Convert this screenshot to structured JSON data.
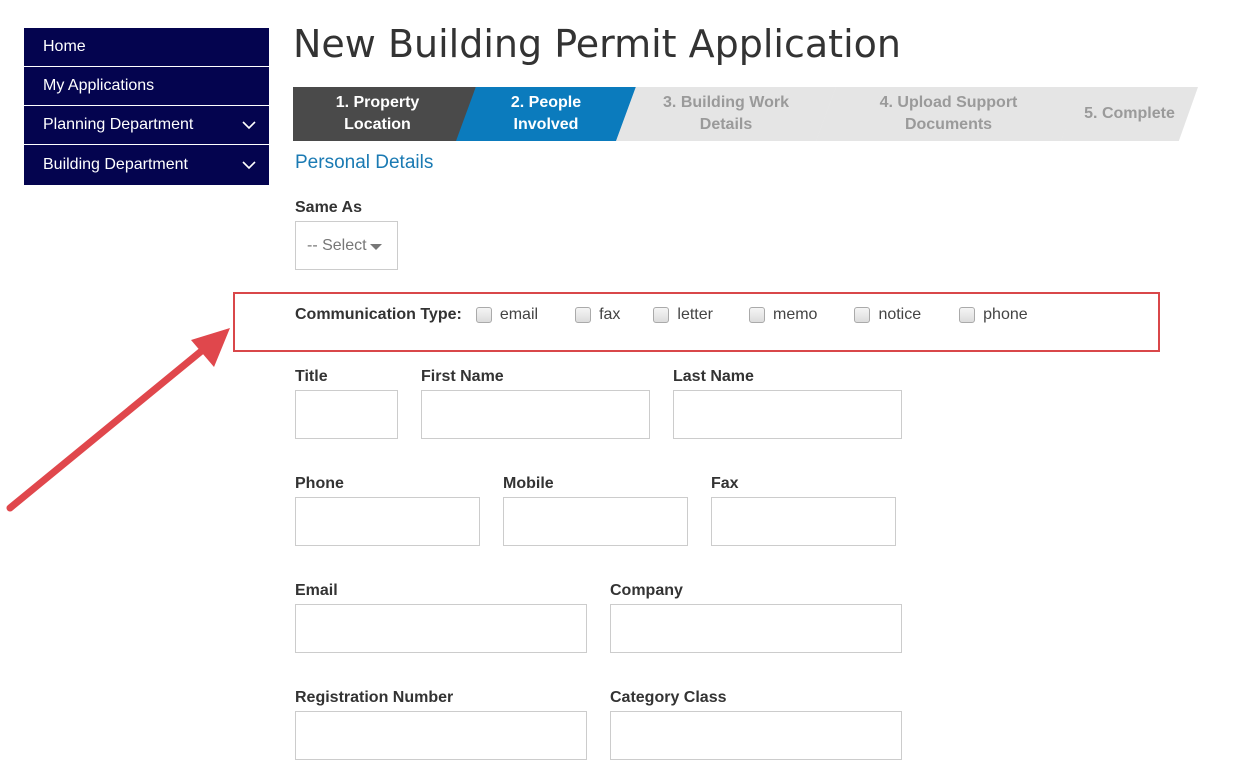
{
  "sidebar": {
    "items": [
      {
        "label": "Home"
      },
      {
        "label": "My Applications"
      },
      {
        "label": "Planning Department"
      },
      {
        "label": "Building Department"
      }
    ]
  },
  "page": {
    "title": "New Building Permit Application"
  },
  "steps": [
    {
      "label": "1. Property Location",
      "state": "completed"
    },
    {
      "label": "2. People Involved",
      "state": "active"
    },
    {
      "label": "3. Building Work Details",
      "state": "pending"
    },
    {
      "label": "4. Upload Support Documents",
      "state": "pending"
    },
    {
      "label": "5. Complete",
      "state": "pending"
    }
  ],
  "section": {
    "title": "Personal Details"
  },
  "same_as": {
    "label": "Same As",
    "selected": "-- Select"
  },
  "communication": {
    "label": "Communication Type:",
    "options": [
      "email",
      "fax",
      "letter",
      "memo",
      "notice",
      "phone"
    ]
  },
  "fields": {
    "title": {
      "label": "Title",
      "value": ""
    },
    "first_name": {
      "label": "First Name",
      "value": ""
    },
    "last_name": {
      "label": "Last Name",
      "value": ""
    },
    "phone": {
      "label": "Phone",
      "value": ""
    },
    "mobile": {
      "label": "Mobile",
      "value": ""
    },
    "fax": {
      "label": "Fax",
      "value": ""
    },
    "email": {
      "label": "Email",
      "value": ""
    },
    "company": {
      "label": "Company",
      "value": ""
    },
    "registration_number": {
      "label": "Registration Number",
      "value": ""
    },
    "category_class": {
      "label": "Category Class",
      "value": ""
    }
  },
  "colors": {
    "sidebar_bg": "#04044f",
    "step_active": "#0b7bbd",
    "step_completed": "#4a4a4a",
    "step_pending": "#e5e5e5",
    "section_title": "#1a7ab3",
    "highlight": "#d9474a"
  },
  "icons": {
    "sidebar_expand": "chevron-down-icon",
    "annotation": "red-arrow-icon"
  }
}
